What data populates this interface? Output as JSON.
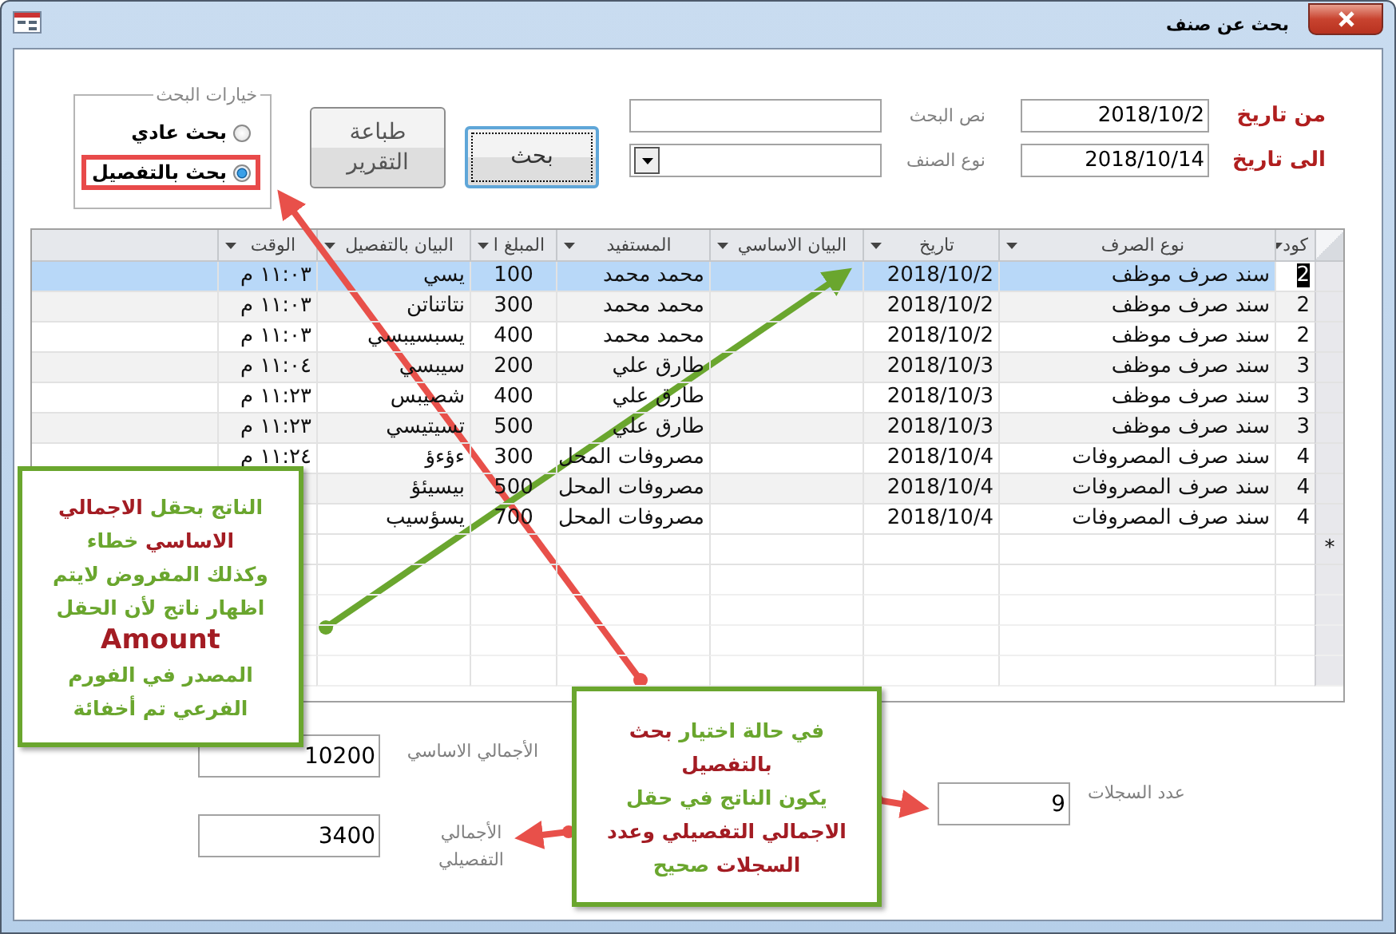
{
  "window": {
    "title": "بحث عن صنف"
  },
  "filters": {
    "from_date": {
      "label": "من تاريخ",
      "value": "2018/10/2"
    },
    "to_date": {
      "label": "الى تاريخ",
      "value": "2018/10/14"
    },
    "search_text": {
      "label": "نص البحث"
    },
    "item_type": {
      "label": "نوع الصنف"
    }
  },
  "buttons": [
    {
      "kind": "search",
      "label": "بحث",
      "focused": true
    },
    {
      "kind": "print",
      "label": "طباعة التقرير",
      "focused": false
    }
  ],
  "search_options": {
    "title": "خيارات البحث",
    "options": [
      {
        "label": "بحث عادي",
        "selected": false,
        "highlighted": false
      },
      {
        "label": "بحث بالتفصيل",
        "selected": true,
        "highlighted": true
      }
    ]
  },
  "table": {
    "columns": [
      "كود",
      "نوع الصرف",
      "تاريخ",
      "البيان الاساسي",
      "المستفيد",
      "المبلغ ا",
      "البيان بالتفصيل",
      "الوقت"
    ],
    "rows": [
      {
        "selected": true,
        "cells": [
          "2",
          "سند صرف موظف",
          "2018/10/2",
          null,
          "محمد محمد",
          "100",
          "يسي",
          "١١:٠٣ م"
        ]
      },
      {
        "selected": false,
        "cells": [
          "2",
          "سند صرف موظف",
          "2018/10/2",
          null,
          "محمد محمد",
          "300",
          "نتاتناتن",
          "١١:٠٣ م"
        ]
      },
      {
        "selected": false,
        "cells": [
          "2",
          "سند صرف موظف",
          "2018/10/2",
          null,
          "محمد محمد",
          "400",
          "يسبسيبسي",
          "١١:٠٣ م"
        ]
      },
      {
        "selected": false,
        "cells": [
          "3",
          "سند صرف موظف",
          "2018/10/3",
          null,
          "طارق علي",
          "200",
          "سيبسي",
          "١١:٠٤ م"
        ]
      },
      {
        "selected": false,
        "cells": [
          "3",
          "سند صرف موظف",
          "2018/10/3",
          null,
          "طارق علي",
          "400",
          "شصيبس",
          "١١:٢٣ م"
        ]
      },
      {
        "selected": false,
        "cells": [
          "3",
          "سند صرف موظف",
          "2018/10/3",
          null,
          "طارق علي",
          "500",
          "تسيتيسي",
          "١١:٢٣ م"
        ]
      },
      {
        "selected": false,
        "cells": [
          "4",
          "سند صرف المصروفات",
          "2018/10/4",
          null,
          "مصروفات المحل",
          "300",
          "ءؤءؤ",
          "١١:٢٤ م"
        ]
      },
      {
        "selected": false,
        "cells": [
          "4",
          "سند صرف المصروفات",
          "2018/10/4",
          null,
          "مصروفات المحل",
          "500",
          "بيسيئؤ",
          null
        ]
      },
      {
        "selected": false,
        "cells": [
          "4",
          "سند صرف المصروفات",
          "2018/10/4",
          null,
          "مصروفات المحل",
          "700",
          "يسؤسيب",
          null
        ]
      }
    ],
    "new_row_marker": "*"
  },
  "totals": {
    "record_count": {
      "label": "عدد السجلات",
      "value": "9"
    },
    "basic_total": {
      "label": "الأجمالي الاساسي",
      "value": "10200"
    },
    "detail_total": {
      "label": "الأجمالي التفصيلي",
      "value": "3400"
    }
  },
  "callouts": [
    {
      "lines": [
        [
          {
            "text": "الناتج بحقل ",
            "color": "#6aa62e"
          },
          {
            "text": "الاجمالي",
            "color": "#a31c23"
          }
        ],
        [
          {
            "text": "الاساسي ",
            "color": "#a31c23"
          },
          {
            "text": "خطاء",
            "color": "#6aa62e"
          }
        ],
        [
          {
            "text": "وكذلك المفروض لايتم",
            "color": "#6aa62e"
          }
        ],
        [
          {
            "text": "اظهار ناتج لأن الحقل",
            "color": "#6aa62e"
          }
        ],
        [
          {
            "text": "Amount",
            "color": "#a31c23"
          }
        ],
        [
          {
            "text": "المصدر في الفورم",
            "color": "#6aa62e"
          }
        ],
        [
          {
            "text": "الفرعي تم أخفائة",
            "color": "#6aa62e"
          }
        ]
      ]
    },
    {
      "lines": [
        [
          {
            "text": "في حالة اختيار ",
            "color": "#6aa62e"
          },
          {
            "text": "بحث",
            "color": "#a31c23"
          }
        ],
        [
          {
            "text": "بالتفصيل",
            "color": "#a31c23"
          }
        ],
        [
          {
            "text": "يكون الناتج في حقل",
            "color": "#6aa62e"
          }
        ],
        [
          {
            "text": "الاجمالي التفصيلي وعدد",
            "color": "#a31c23"
          }
        ],
        [
          {
            "text": "السجلات ",
            "color": "#a31c23"
          },
          {
            "text": "صحيح",
            "color": "#6aa62e"
          }
        ]
      ]
    }
  ]
}
